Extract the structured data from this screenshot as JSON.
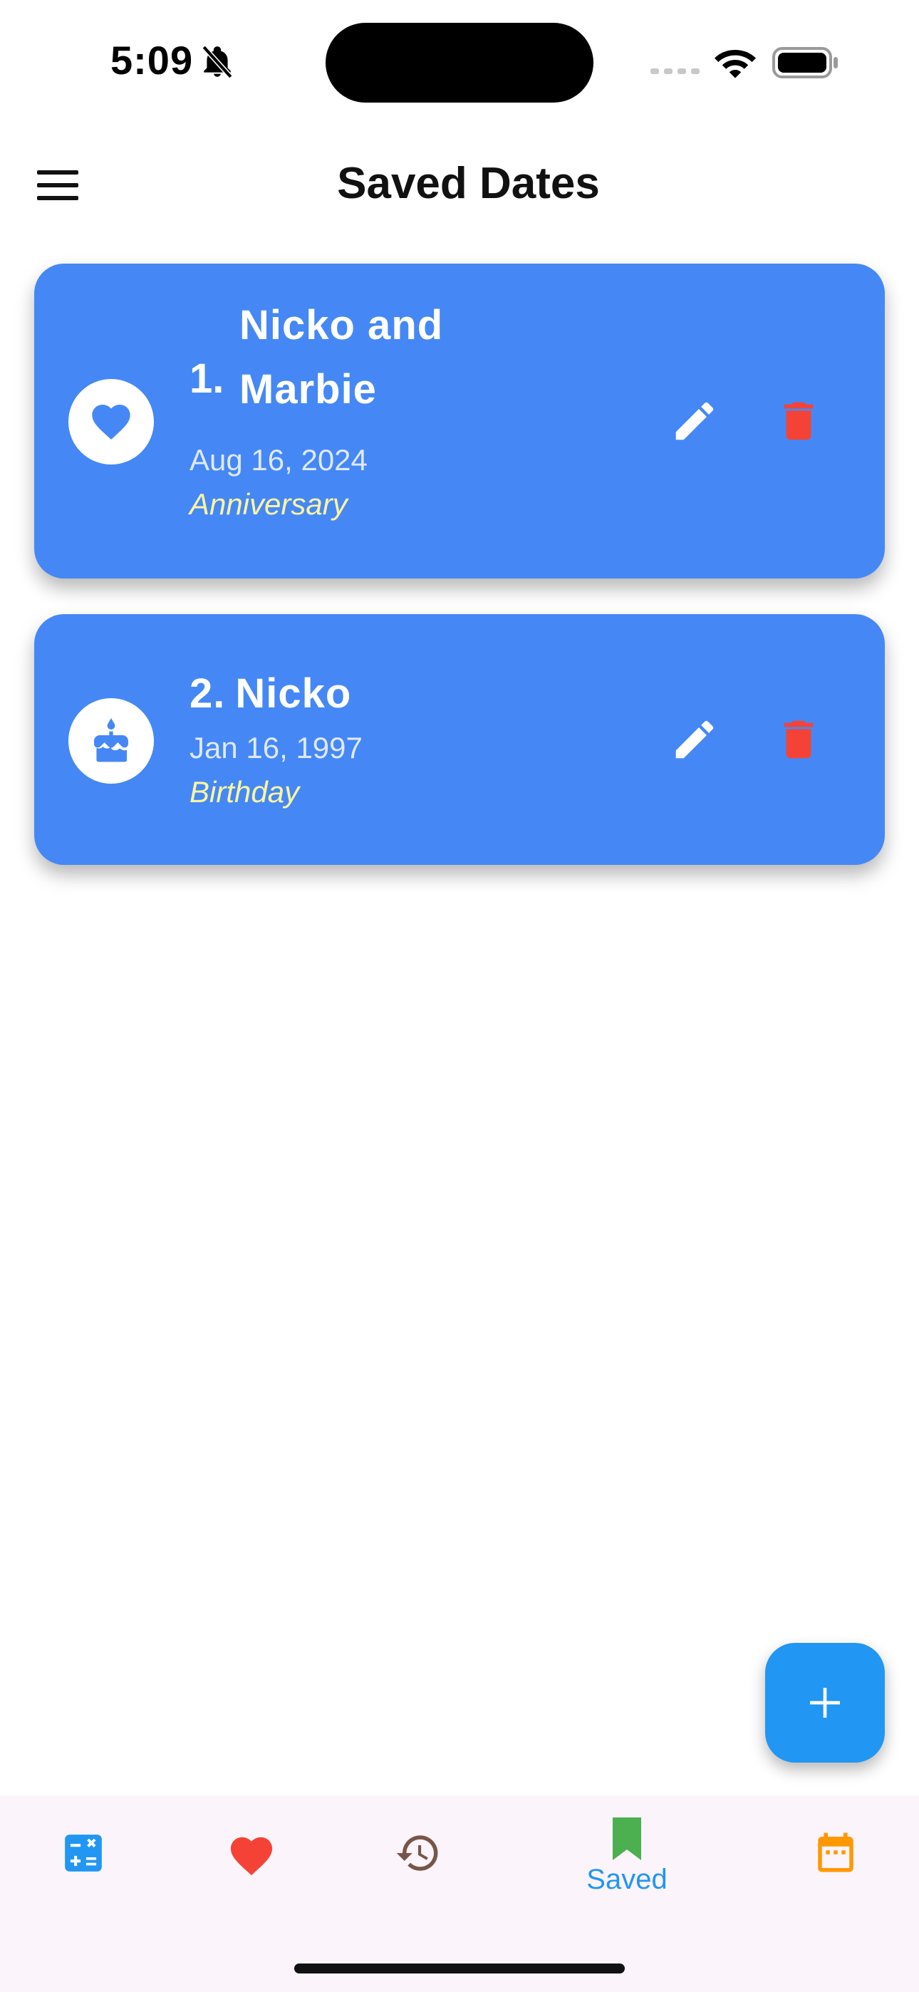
{
  "status_bar": {
    "time": "5:09"
  },
  "app_bar": {
    "title": "Saved Dates"
  },
  "saved_dates": [
    {
      "index": "1.",
      "name": "Nicko and Marbie",
      "date": "Aug 16, 2024",
      "type": "Anniversary",
      "icon": "heart-icon"
    },
    {
      "index": "2.",
      "name": "Nicko",
      "date": "Jan 16, 1997",
      "type": "Birthday",
      "icon": "cake-icon"
    }
  ],
  "bottom_nav": {
    "items": [
      {
        "icon": "calculator-icon",
        "color": "#2196f3"
      },
      {
        "icon": "heart-icon",
        "color": "#f44336"
      },
      {
        "icon": "history-icon",
        "color": "#795548"
      },
      {
        "icon": "bookmark-icon",
        "color": "#4caf50",
        "label": "Saved",
        "selected": true
      },
      {
        "icon": "calendar-icon",
        "color": "#ff9800"
      }
    ]
  },
  "colors": {
    "card": "#4588f5",
    "fab": "#2196f3",
    "delete": "#f44336",
    "type_text": "#fff59d"
  }
}
